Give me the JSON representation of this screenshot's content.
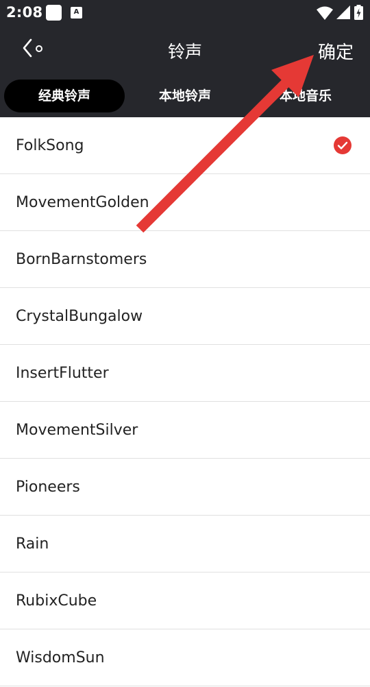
{
  "status_bar": {
    "time": "2:08",
    "icons": [
      "notification-square-icon",
      "a-badge-icon",
      "wifi-icon",
      "signal-icon",
      "battery-icon"
    ],
    "a_badge": "A"
  },
  "header": {
    "back_icon": "back-chevron-icon",
    "title": "铃声",
    "confirm_label": "确定"
  },
  "tabs": [
    {
      "label": "经典铃声",
      "active": true
    },
    {
      "label": "本地铃声",
      "active": false
    },
    {
      "label": "本地音乐",
      "active": false
    }
  ],
  "ringtones": [
    {
      "name": "FolkSong",
      "selected": true
    },
    {
      "name": "MovementGolden",
      "selected": false
    },
    {
      "name": "BornBarnstomers",
      "selected": false
    },
    {
      "name": "CrystalBungalow",
      "selected": false
    },
    {
      "name": "InsertFlutter",
      "selected": false
    },
    {
      "name": "MovementSilver",
      "selected": false
    },
    {
      "name": "Pioneers",
      "selected": false
    },
    {
      "name": "Rain",
      "selected": false
    },
    {
      "name": "RubixCube",
      "selected": false
    },
    {
      "name": "WisdomSun",
      "selected": false
    }
  ],
  "colors": {
    "header_bg": "#26272c",
    "active_tab_bg": "#000000",
    "check_color": "#e53935",
    "annotation_arrow": "#e53935"
  },
  "annotation": {
    "type": "arrow",
    "icon": "annotation-arrow-icon"
  }
}
